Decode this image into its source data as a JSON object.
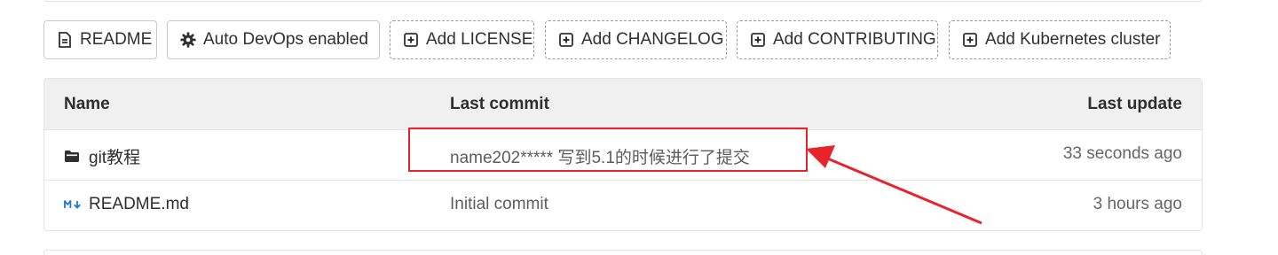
{
  "toolbar": {
    "buttons": [
      {
        "label": "README",
        "icon": "file-text-icon"
      },
      {
        "label": "Auto DevOps enabled",
        "icon": "gear-icon"
      },
      {
        "label": "Add LICENSE",
        "icon": "plus-square-icon"
      },
      {
        "label": "Add CHANGELOG",
        "icon": "plus-square-icon"
      },
      {
        "label": "Add CONTRIBUTING",
        "icon": "plus-square-icon"
      },
      {
        "label": "Add Kubernetes cluster",
        "icon": "plus-square-icon"
      }
    ]
  },
  "table": {
    "headers": {
      "name": "Name",
      "last_commit": "Last commit",
      "last_update": "Last update"
    },
    "rows": [
      {
        "icon": "folder-icon",
        "name": "git教程",
        "commit": "name202***** 写到5.1的时候进行了提交",
        "updated": "33 seconds ago"
      },
      {
        "icon": "markdown-icon",
        "name": "README.md",
        "commit": "Initial commit",
        "updated": "3 hours ago"
      }
    ]
  },
  "annotation": {
    "color": "#e8242b"
  }
}
